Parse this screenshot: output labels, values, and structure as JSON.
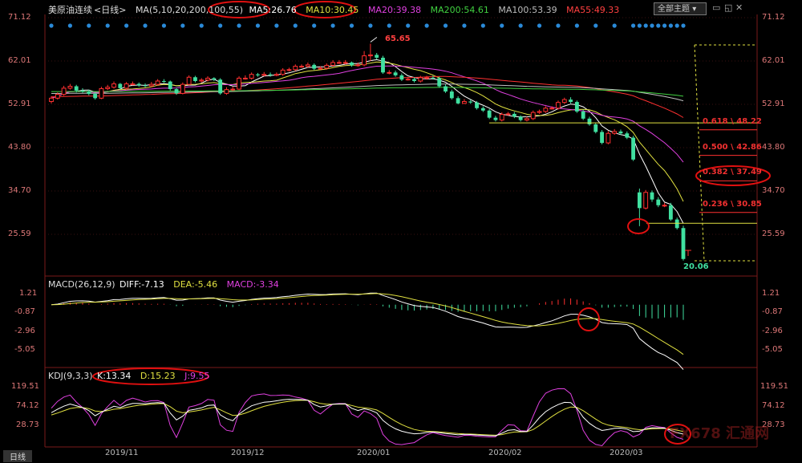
{
  "header": {
    "instrument": "美原油连续",
    "period": "<日线>",
    "ma_params": "MA(5,10,20,200,100,55)",
    "ma5": "MA5:26.76",
    "ma10": "MA10:30.45",
    "ma20": "MA20:39.38",
    "ma200": "MA200:54.61",
    "ma100": "MA100:53.39",
    "ma55": "MA55:49.33",
    "theme_button": "全部主题"
  },
  "macd_header": {
    "params": "MACD(26,12,9)",
    "diff": "DIFF:-7.13",
    "dea": "DEA:-5.46",
    "macd": "MACD:-3.34"
  },
  "kdj_header": {
    "params": "KDJ(9,3,3)",
    "k": "K:13.34",
    "d": "D:15.23",
    "j": "J:9.55"
  },
  "bottom_tab": "日线",
  "watermark": "FX678 汇通网",
  "colors": {
    "background": "#000000",
    "up": "#ff3030",
    "down": "#40e0a0",
    "ma5": "#ffffff",
    "ma10": "#e0e040",
    "ma20": "#e040e0",
    "ma200": "#40d040",
    "ma100": "#c0c0c0",
    "ma55": "#ff3030",
    "axis_text": "#dd7777",
    "fib_text": "#ff3030",
    "grid": "#3a1010",
    "annotation_ring": "#e01010"
  },
  "chart_data": [
    {
      "type": "candlestick",
      "name": "price",
      "y_ticks": [
        "71.12",
        "62.01",
        "52.91",
        "43.80",
        "34.70",
        "25.59"
      ],
      "ylim": [
        17.5,
        74.0
      ],
      "x_labels": [
        "2019/11",
        "2019/12",
        "2020/01",
        "2020/02",
        "2020/03"
      ],
      "high_label": "65.65",
      "low_label": "20.06",
      "fibonacci": [
        {
          "label": "0.618 \\ 48.22",
          "value": 48.22
        },
        {
          "label": "0.500 \\ 42.86",
          "value": 42.86
        },
        {
          "label": "0.382 \\ 37.49",
          "value": 37.49
        },
        {
          "label": "0.236 \\ 30.85",
          "value": 30.85
        }
      ],
      "support_lines": [
        49.0,
        27.9
      ],
      "dates": [
        "2019-10-22",
        "2019-10-23",
        "2019-10-24",
        "2019-10-25",
        "2019-10-28",
        "2019-10-29",
        "2019-10-30",
        "2019-10-31",
        "2019-11-01",
        "2019-11-04",
        "2019-11-05",
        "2019-11-06",
        "2019-11-07",
        "2019-11-08",
        "2019-11-11",
        "2019-11-12",
        "2019-11-13",
        "2019-11-14",
        "2019-11-15",
        "2019-11-18",
        "2019-11-19",
        "2019-11-20",
        "2019-11-21",
        "2019-11-22",
        "2019-11-25",
        "2019-11-26",
        "2019-11-27",
        "2019-11-29",
        "2019-12-02",
        "2019-12-03",
        "2019-12-04",
        "2019-12-05",
        "2019-12-06",
        "2019-12-09",
        "2019-12-10",
        "2019-12-11",
        "2019-12-12",
        "2019-12-13",
        "2019-12-16",
        "2019-12-17",
        "2019-12-18",
        "2019-12-19",
        "2019-12-20",
        "2019-12-23",
        "2019-12-24",
        "2019-12-26",
        "2019-12-27",
        "2019-12-30",
        "2019-12-31",
        "2020-01-02",
        "2020-01-03",
        "2020-01-06",
        "2020-01-07",
        "2020-01-08",
        "2020-01-09",
        "2020-01-10",
        "2020-01-13",
        "2020-01-14",
        "2020-01-15",
        "2020-01-16",
        "2020-01-17",
        "2020-01-21",
        "2020-01-22",
        "2020-01-23",
        "2020-01-24",
        "2020-01-27",
        "2020-01-28",
        "2020-01-29",
        "2020-01-30",
        "2020-01-31",
        "2020-02-03",
        "2020-02-04",
        "2020-02-05",
        "2020-02-06",
        "2020-02-07",
        "2020-02-10",
        "2020-02-11",
        "2020-02-12",
        "2020-02-13",
        "2020-02-14",
        "2020-02-18",
        "2020-02-19",
        "2020-02-20",
        "2020-02-21",
        "2020-02-24",
        "2020-02-25",
        "2020-02-26",
        "2020-02-27",
        "2020-02-28",
        "2020-03-02",
        "2020-03-03",
        "2020-03-04",
        "2020-03-05",
        "2020-03-06",
        "2020-03-09",
        "2020-03-10",
        "2020-03-11",
        "2020-03-12",
        "2020-03-13",
        "2020-03-16",
        "2020-03-17",
        "2020-03-18"
      ],
      "close": [
        54.2,
        55.0,
        56.3,
        56.7,
        55.8,
        55.6,
        55.1,
        54.2,
        56.2,
        56.5,
        57.2,
        56.3,
        57.2,
        57.2,
        56.9,
        56.8,
        57.1,
        57.8,
        57.7,
        56.1,
        55.2,
        57.1,
        58.6,
        57.8,
        58.0,
        58.4,
        58.1,
        55.2,
        56.0,
        56.1,
        58.4,
        58.4,
        59.2,
        59.0,
        59.2,
        59.0,
        59.2,
        60.1,
        60.2,
        60.9,
        60.9,
        61.2,
        60.4,
        60.5,
        61.1,
        61.7,
        61.7,
        61.7,
        61.1,
        61.2,
        63.1,
        63.3,
        62.7,
        59.6,
        59.6,
        59.0,
        58.1,
        58.2,
        57.8,
        58.5,
        58.5,
        58.4,
        56.7,
        55.6,
        54.2,
        53.1,
        53.5,
        53.3,
        52.1,
        51.6,
        50.1,
        49.6,
        50.8,
        50.9,
        50.3,
        49.6,
        49.9,
        51.2,
        51.4,
        52.1,
        52.1,
        53.3,
        53.9,
        53.4,
        51.4,
        49.9,
        48.7,
        47.1,
        44.8,
        46.8,
        47.2,
        46.8,
        45.9,
        41.3,
        31.1,
        34.4,
        32.9,
        31.7,
        31.7,
        28.7,
        26.9,
        20.4
      ],
      "open": [
        53.5,
        54.2,
        55.0,
        56.3,
        56.7,
        55.8,
        55.6,
        55.1,
        54.2,
        56.2,
        56.5,
        57.2,
        56.3,
        57.2,
        57.2,
        56.9,
        56.8,
        57.1,
        57.8,
        57.7,
        56.1,
        55.2,
        57.1,
        58.6,
        57.8,
        58.0,
        58.4,
        58.1,
        55.2,
        56.0,
        56.1,
        58.4,
        58.4,
        59.2,
        59.0,
        59.2,
        59.0,
        59.2,
        60.1,
        60.2,
        60.9,
        60.9,
        61.2,
        60.4,
        60.5,
        61.1,
        61.7,
        61.7,
        61.7,
        61.1,
        61.2,
        63.1,
        63.3,
        62.7,
        59.6,
        59.6,
        59.0,
        58.1,
        58.2,
        57.8,
        58.5,
        58.5,
        58.4,
        56.7,
        55.6,
        54.2,
        53.1,
        53.5,
        53.3,
        52.1,
        51.6,
        50.1,
        49.6,
        50.8,
        50.9,
        50.3,
        49.6,
        49.9,
        51.2,
        51.4,
        52.1,
        52.1,
        53.3,
        53.9,
        53.4,
        51.4,
        49.9,
        48.7,
        47.1,
        44.8,
        46.8,
        47.2,
        46.8,
        45.9,
        34.4,
        31.1,
        34.4,
        32.9,
        31.7,
        31.7,
        28.7,
        26.9
      ],
      "high": [
        54.6,
        55.4,
        56.8,
        57.2,
        57.0,
        56.3,
        56.0,
        55.4,
        56.6,
        57.0,
        57.7,
        57.4,
        57.6,
        57.7,
        57.5,
        57.3,
        57.6,
        58.2,
        58.2,
        57.9,
        56.4,
        57.5,
        59.0,
        58.9,
        58.4,
        58.8,
        58.6,
        58.4,
        56.5,
        56.6,
        58.8,
        59.0,
        59.6,
        59.5,
        59.7,
        59.6,
        59.6,
        60.5,
        60.6,
        61.3,
        61.3,
        61.7,
        61.5,
        60.9,
        61.5,
        62.2,
        62.2,
        62.2,
        61.9,
        61.7,
        64.1,
        65.65,
        63.7,
        63.1,
        60.1,
        60.0,
        59.4,
        58.6,
        58.6,
        58.9,
        58.9,
        58.9,
        58.7,
        57.1,
        56.0,
        54.6,
        54.0,
        53.9,
        53.6,
        52.5,
        51.9,
        50.5,
        51.2,
        51.3,
        51.3,
        50.6,
        50.3,
        51.6,
        51.8,
        52.5,
        52.5,
        53.7,
        54.3,
        54.4,
        53.7,
        51.8,
        50.3,
        49.1,
        47.5,
        47.3,
        47.7,
        47.6,
        47.2,
        46.3,
        35.2,
        34.9,
        34.8,
        33.4,
        32.2,
        32.2,
        29.1,
        27.4
      ],
      "low": [
        53.1,
        53.9,
        54.7,
        56.0,
        55.4,
        55.3,
        54.8,
        53.9,
        54.0,
        55.9,
        56.2,
        56.0,
        56.0,
        56.9,
        56.6,
        56.5,
        56.5,
        56.8,
        57.4,
        55.8,
        54.9,
        55.0,
        56.9,
        57.5,
        57.5,
        57.7,
        57.8,
        54.9,
        54.9,
        55.7,
        55.9,
        58.1,
        58.1,
        58.7,
        58.8,
        58.7,
        58.8,
        58.9,
        59.8,
        59.9,
        60.6,
        60.6,
        60.1,
        60.2,
        60.2,
        60.8,
        61.4,
        61.3,
        60.8,
        60.8,
        60.9,
        62.0,
        62.3,
        59.3,
        59.2,
        58.7,
        57.8,
        57.9,
        57.5,
        57.5,
        58.1,
        58.1,
        56.4,
        55.3,
        53.9,
        52.9,
        53.0,
        53.0,
        51.8,
        51.3,
        49.8,
        49.3,
        49.3,
        50.5,
        50.0,
        49.3,
        49.3,
        49.6,
        50.9,
        51.1,
        51.8,
        51.8,
        53.0,
        53.1,
        51.1,
        49.6,
        48.4,
        46.8,
        44.5,
        44.5,
        46.5,
        46.5,
        45.6,
        41.0,
        27.3,
        30.8,
        32.4,
        31.3,
        31.3,
        28.4,
        26.6,
        20.06
      ],
      "ma5_tail": 26.76,
      "ma10_tail": 30.45,
      "ma20_tail": 39.38,
      "ma55_tail": 49.33,
      "ma100_tail": 53.39,
      "ma200_tail": 54.61
    },
    {
      "type": "bar",
      "name": "macd",
      "y_ticks": [
        "1.21",
        "-0.87",
        "-2.96",
        "-5.05"
      ],
      "ylim": [
        -7.6,
        2.3
      ],
      "series": [
        {
          "name": "DIFF",
          "last": -7.13
        },
        {
          "name": "DEA",
          "last": -5.46
        },
        {
          "name": "MACD",
          "last": -3.34
        }
      ]
    },
    {
      "type": "line",
      "name": "kdj",
      "y_ticks": [
        "119.51",
        "74.12",
        "28.73"
      ],
      "ylim": [
        0,
        130
      ],
      "series": [
        {
          "name": "K",
          "last": 13.34
        },
        {
          "name": "D",
          "last": 15.23
        },
        {
          "name": "J",
          "last": 9.55
        }
      ]
    }
  ]
}
